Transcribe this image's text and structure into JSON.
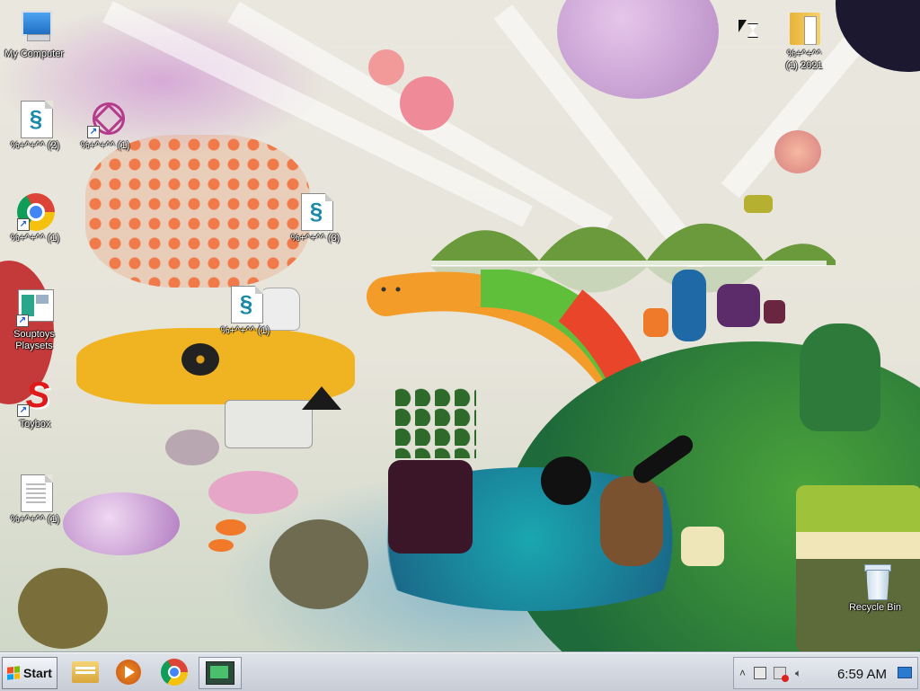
{
  "desktop": {
    "icons": [
      {
        "label": "My Computer"
      },
      {
        "label": "%+^+^^ (2)"
      },
      {
        "label": "%+^+^^ (1)"
      },
      {
        "label": "%+^+^^ (1)"
      },
      {
        "label": "%+^+^^ (3)"
      },
      {
        "label": "Souptoys\nPlaysets"
      },
      {
        "label": "%+^+^^ (1)"
      },
      {
        "label": "Toybox"
      },
      {
        "label": "%+^+^^ (1)"
      },
      {
        "label": "%+^+^^\n(1) 2021"
      },
      {
        "label": "Recycle Bin"
      }
    ]
  },
  "taskbar": {
    "start_label": "Start",
    "pinned": [
      {
        "icon": "folder-icon"
      },
      {
        "icon": "media-player-icon"
      },
      {
        "icon": "chrome-icon"
      },
      {
        "icon": "app-window-icon"
      }
    ]
  },
  "tray": {
    "show_hidden": "˄",
    "time": "6:59 AM"
  },
  "colors": {
    "taskbar": "#d3d8e0",
    "chrome_red": "#db4437",
    "chrome_yellow": "#f4c20d",
    "chrome_green": "#0f9d58",
    "chrome_blue": "#4285f4"
  }
}
